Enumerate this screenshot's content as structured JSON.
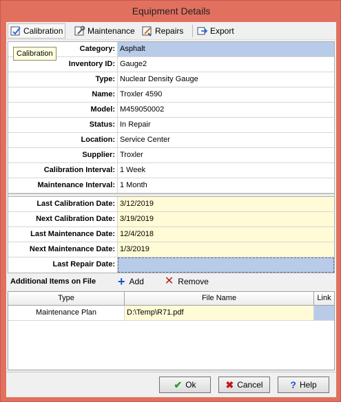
{
  "window": {
    "title": "Equipment Details"
  },
  "toolbar": {
    "calibration_label": "Calibration",
    "maintenance_label": "Maintenance",
    "repairs_label": "Repairs",
    "export_label": "Export"
  },
  "tooltip": {
    "text": "Calibration"
  },
  "fields": [
    {
      "label": "Category:",
      "value": "Asphalt"
    },
    {
      "label": "Inventory ID:",
      "value": "Gauge2"
    },
    {
      "label": "Type:",
      "value": "Nuclear Density Gauge"
    },
    {
      "label": "Name:",
      "value": "Troxler 4590"
    },
    {
      "label": "Model:",
      "value": "M459050002"
    },
    {
      "label": "Status:",
      "value": "In Repair"
    },
    {
      "label": "Location:",
      "value": "Service Center"
    },
    {
      "label": "Supplier:",
      "value": "Troxler"
    },
    {
      "label": "Calibration Interval:",
      "value": "1 Week"
    },
    {
      "label": "Maintenance Interval:",
      "value": "1 Month"
    }
  ],
  "dates": [
    {
      "label": "Last Calibration Date:",
      "value": "3/12/2019"
    },
    {
      "label": "Next Calibration Date:",
      "value": "3/19/2019"
    },
    {
      "label": "Last Maintenance Date:",
      "value": "12/4/2018"
    },
    {
      "label": "Next Maintenance Date:",
      "value": "1/3/2019"
    },
    {
      "label": "Last Repair Date:",
      "value": ""
    }
  ],
  "items": {
    "title": "Additional Items on File",
    "add_label": "Add",
    "remove_label": "Remove",
    "columns": [
      "Type",
      "File Name",
      "Link"
    ],
    "rows": [
      {
        "type": "Maintenance Plan",
        "file": "D:\\Temp\\R71.pdf",
        "link": ""
      }
    ]
  },
  "buttons": {
    "ok": "Ok",
    "cancel": "Cancel",
    "help": "Help"
  },
  "colors": {
    "frame": "#e2705f",
    "selected": "#b8cbe8",
    "editable": "#fefbd6"
  }
}
